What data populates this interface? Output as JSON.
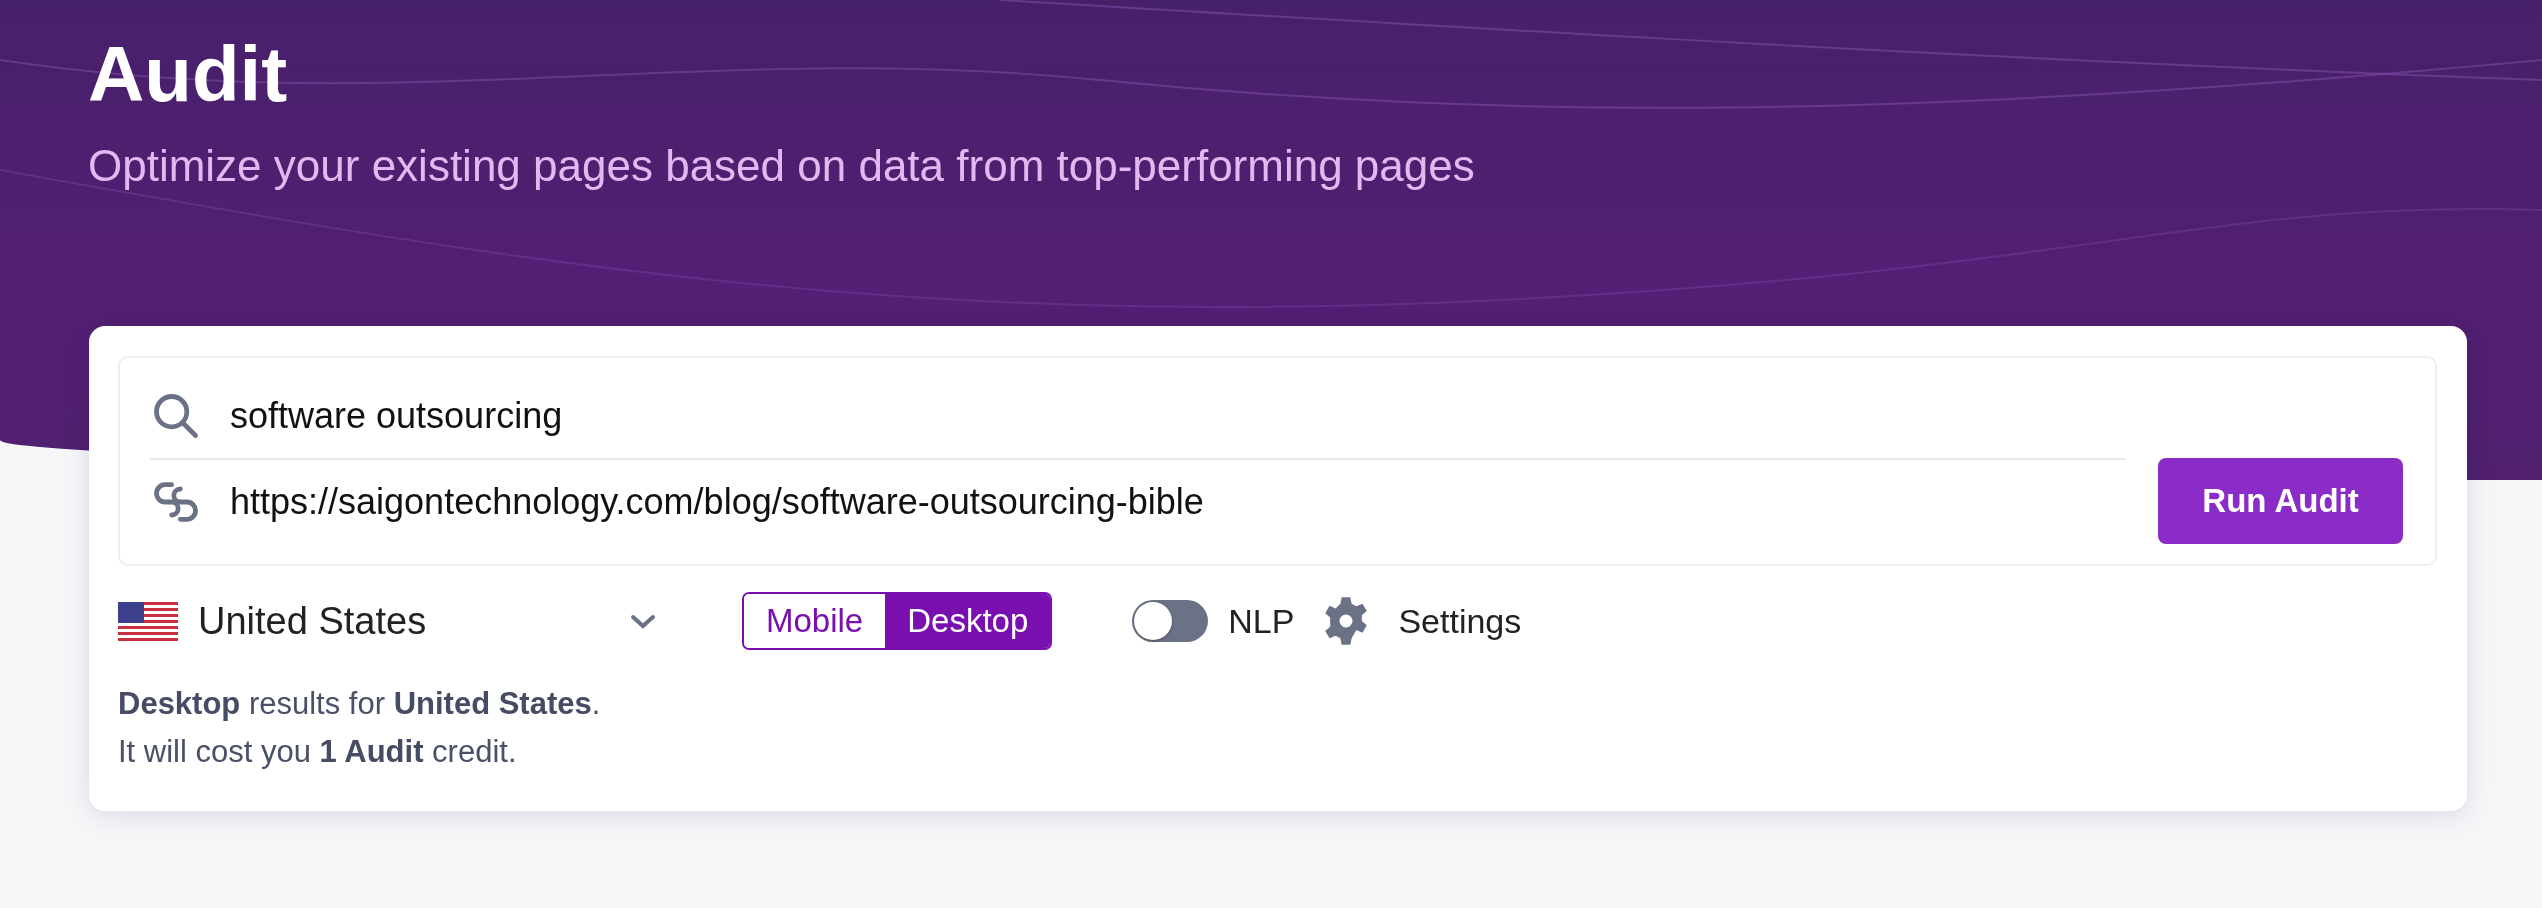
{
  "header": {
    "title": "Audit",
    "subtitle": "Optimize your existing pages based on data from top-performing pages"
  },
  "query": {
    "keyword": "software outsourcing",
    "url": "https://saigontechnology.com/blog/software-outsourcing-bible"
  },
  "run_button": "Run Audit",
  "country": {
    "label": "United States"
  },
  "device_tabs": [
    {
      "label": "Mobile",
      "selected": false
    },
    {
      "label": "Desktop",
      "selected": true
    }
  ],
  "nlp": {
    "label": "NLP",
    "on": false
  },
  "settings": "Settings",
  "summary": [
    "**Desktop** results for **United States**.",
    "It will cost you **1 Audit** credit."
  ]
}
